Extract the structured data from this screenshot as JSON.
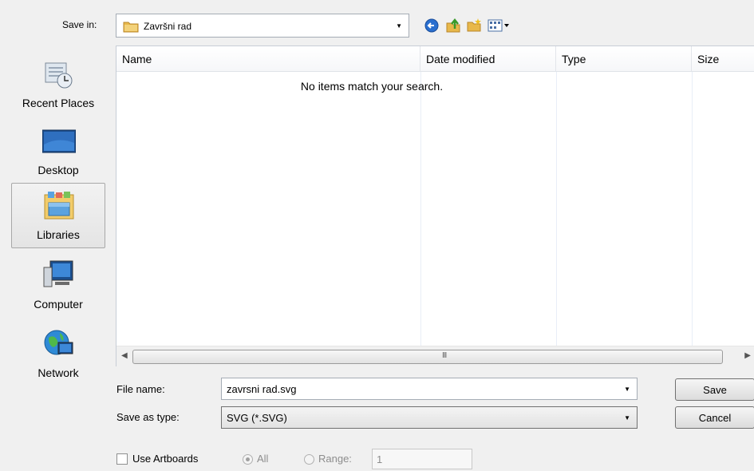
{
  "save_in": {
    "label": "Save in:",
    "value": "Završni rad"
  },
  "toolbar": {
    "back_icon": "back-arrow-icon",
    "up_icon": "up-folder-icon",
    "new_folder_icon": "new-folder-icon",
    "view_icon": "view-menu-icon"
  },
  "places": [
    {
      "label": "Recent Places",
      "icon": "recent-places-icon"
    },
    {
      "label": "Desktop",
      "icon": "desktop-icon"
    },
    {
      "label": "Libraries",
      "icon": "libraries-icon",
      "selected": true
    },
    {
      "label": "Computer",
      "icon": "computer-icon"
    },
    {
      "label": "Network",
      "icon": "network-icon"
    }
  ],
  "file_list": {
    "columns": [
      "Name",
      "Date modified",
      "Type",
      "Size"
    ],
    "empty_message": "No items match your search.",
    "scroll_grip": "III"
  },
  "form": {
    "file_name_label": "File name:",
    "file_name_value": "zavrsni rad.svg",
    "save_as_type_label": "Save as type:",
    "save_as_type_value": "SVG (*.SVG)",
    "save_button": "Save",
    "cancel_button": "Cancel"
  },
  "options": {
    "use_artboards_label": "Use Artboards",
    "use_artboards_checked": false,
    "all_label": "All",
    "range_label": "Range:",
    "range_value": "1"
  },
  "colors": {
    "dialog_bg": "#f0f0f0",
    "list_bg": "#ffffff",
    "selected_place": "#e4e4e4"
  }
}
